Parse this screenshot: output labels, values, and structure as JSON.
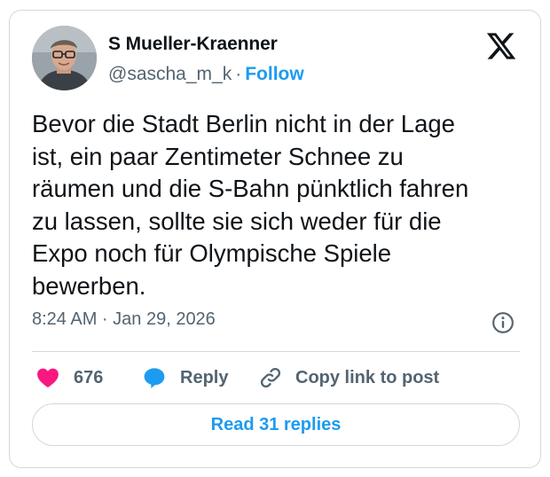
{
  "author": {
    "name": "S Mueller-Kraenner",
    "handle": "@sascha_m_k",
    "separator": "·",
    "follow_label": "Follow"
  },
  "brand": {
    "logo_icon": "x-logo-icon"
  },
  "tweet": {
    "lines": [
      "Bevor die Stadt Berlin nicht in der Lage",
      "ist, ein paar Zentimeter Schnee zu",
      "räumen und die S-Bahn pünktlich fahren",
      "zu lassen, sollte sie sich weder für die",
      "Expo noch für Olympische Spiele",
      "bewerben."
    ],
    "timestamp": "8:24 AM · Jan 29, 2026"
  },
  "actions": {
    "like_count": "676",
    "reply_label": "Reply",
    "copy_label": "Copy link to post"
  },
  "replies_button": "Read 31 replies",
  "colors": {
    "accent": "#1d9bf0",
    "like": "#f91880",
    "text": "#0f1419",
    "secondary": "#536471",
    "border": "#cfd9de"
  }
}
